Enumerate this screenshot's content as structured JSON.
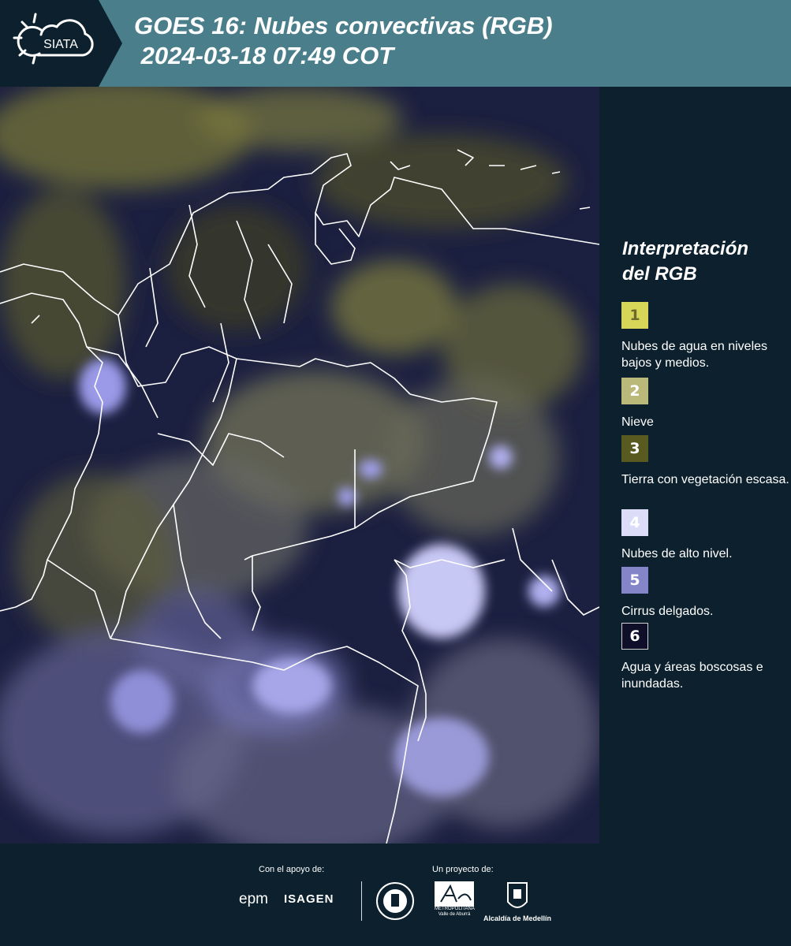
{
  "header": {
    "title": "GOES 16: Nubes convectivas (RGB)\n 2024-03-18 07:49 COT",
    "logo_text": "SIATA"
  },
  "legend": {
    "title": "Interpretación del RGB",
    "items": [
      {
        "num": "1",
        "label": "Nubes de agua en niveles bajos y medios.",
        "color": "#d7d659",
        "num_color": "#6a6a2a"
      },
      {
        "num": "2",
        "label": "Nieve",
        "color": "#bab97a",
        "num_color": "#ffffff"
      },
      {
        "num": "3",
        "label": "Tierra con vegetación escasa.",
        "color": "#595a1f",
        "num_color": "#ffffff"
      },
      {
        "num": "4",
        "label": "Nubes de alto nivel.",
        "color": "#dcdcf8",
        "num_color": "#ffffff"
      },
      {
        "num": "5",
        "label": "Cirrus delgados.",
        "color": "#8485c8",
        "num_color": "#ffffff"
      },
      {
        "num": "6",
        "label": "Agua y áreas boscosas e inundadas.",
        "color": "#0f0f2a",
        "num_color": "#ffffff"
      }
    ]
  },
  "footer": {
    "support_label": "Con el apoyo de:",
    "project_label": "Un proyecto de:",
    "sponsors": [
      "epm",
      "ISAGEN"
    ],
    "alcaldia": "Alcaldía de Medellín",
    "amva": "METROPOLITANA Valle de Aburrá"
  },
  "colors": {
    "header_bg": "#4b7e8b",
    "panel_bg": "#0c202d",
    "logo_bg": "#0c202d"
  }
}
